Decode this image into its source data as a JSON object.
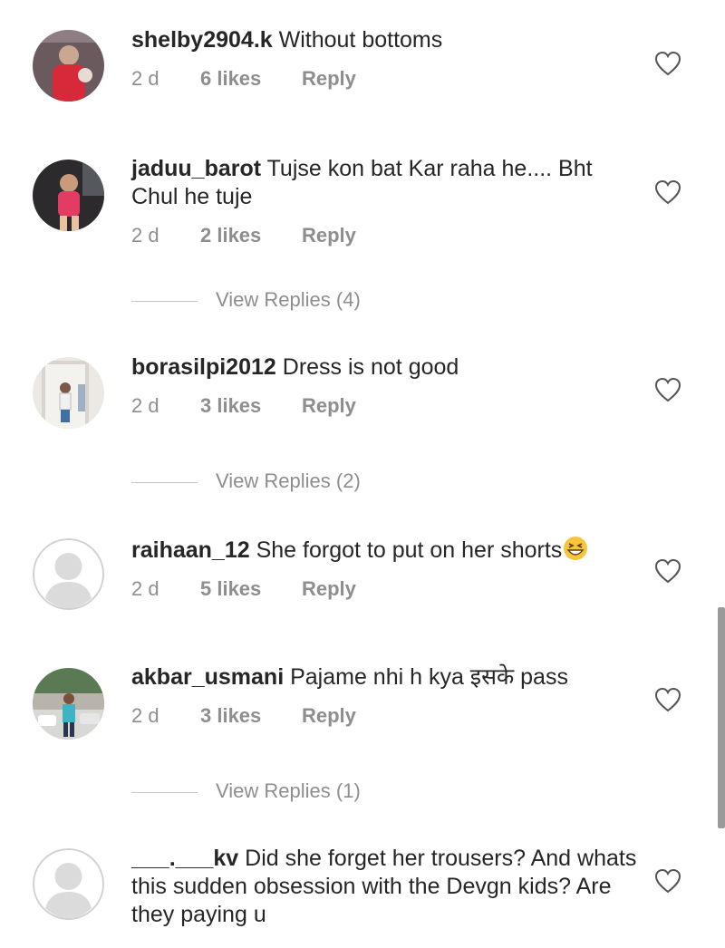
{
  "comments": [
    {
      "username": "shelby2904.k",
      "text": "Without bottoms",
      "time": "2 d",
      "likes": "6 likes",
      "reply": "Reply",
      "avatar": "photo-avatar-red"
    },
    {
      "username": "jaduu_barot",
      "text": "Tujse kon bat Kar raha he.... Bht Chul he tuje",
      "time": "2 d",
      "likes": "2 likes",
      "reply": "Reply",
      "avatar": "photo-avatar-child",
      "view_replies": "View Replies (4)"
    },
    {
      "username": "borasilpi2012",
      "text": "Dress is not good",
      "time": "2 d",
      "likes": "3 likes",
      "reply": "Reply",
      "avatar": "photo-avatar-doorway",
      "view_replies": "View Replies (2)"
    },
    {
      "username": "raihaan_12",
      "text": "She forgot to put on her shorts",
      "emoji": "grinning-squinting-face",
      "time": "2 d",
      "likes": "5 likes",
      "reply": "Reply",
      "avatar": "default-avatar"
    },
    {
      "username": "akbar_usmani",
      "text": "Pajame nhi h kya इसके pass",
      "time": "2 d",
      "likes": "3 likes",
      "reply": "Reply",
      "avatar": "photo-avatar-outdoor",
      "view_replies": "View Replies (1)"
    },
    {
      "username": "___.___kv",
      "text": "Did she forget her trousers? And whats this sudden obsession with the Devgn kids? Are they paying u",
      "avatar": "default-avatar"
    }
  ],
  "icons": {
    "like": "heart-outline-icon"
  },
  "colors": {
    "text": "#262626",
    "muted": "#8e8e8e",
    "divider": "#c7c7c7"
  }
}
